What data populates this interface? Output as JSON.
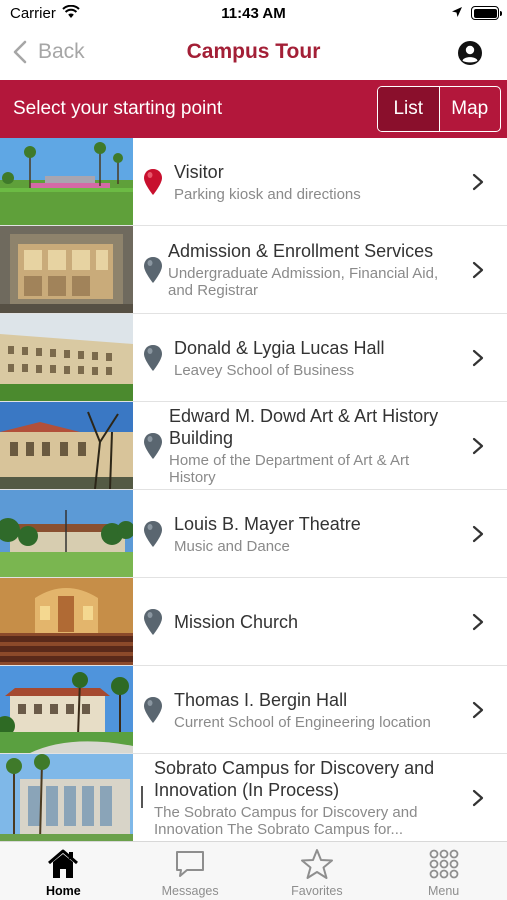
{
  "status_bar": {
    "carrier": "Carrier",
    "time": "11:43 AM"
  },
  "nav": {
    "back_label": "Back",
    "title": "Campus Tour"
  },
  "band": {
    "prompt": "Select your starting point",
    "segments": [
      "List",
      "Map"
    ],
    "selected": "List"
  },
  "colors": {
    "accent": "#b3173b",
    "title": "#a31f36",
    "pin_active": "#c8102e",
    "pin_inactive": "#5a6670"
  },
  "locations": [
    {
      "title": "Visitor",
      "subtitle": "Parking kiosk and directions",
      "pin": "pin-red-icon"
    },
    {
      "title": "Admission & Enrollment Services",
      "subtitle": "Undergraduate Admission, Financial Aid, and Registrar",
      "pin": "pin-gray-icon"
    },
    {
      "title": "Donald & Lygia Lucas Hall",
      "subtitle": "Leavey School of Business",
      "pin": "pin-gray-icon"
    },
    {
      "title": "Edward M. Dowd Art & Art History Building",
      "subtitle": "Home of the Department of Art & Art History",
      "pin": "pin-gray-icon"
    },
    {
      "title": "Louis B. Mayer Theatre",
      "subtitle": "Music and Dance",
      "pin": "pin-gray-icon"
    },
    {
      "title": "Mission Church",
      "subtitle": "",
      "pin": "pin-gray-icon"
    },
    {
      "title": "Thomas I. Bergin Hall",
      "subtitle": "Current School of Engineering location",
      "pin": "pin-gray-icon"
    },
    {
      "title": "Sobrato Campus for Discovery and Innovation (In Process)",
      "subtitle": "The Sobrato Campus for Discovery and Innovation The Sobrato Campus for...",
      "pin": "pin-gray-icon"
    }
  ],
  "tabs": [
    {
      "label": "Home",
      "icon": "home-icon",
      "active": true
    },
    {
      "label": "Messages",
      "icon": "chat-bubble-icon",
      "active": false
    },
    {
      "label": "Favorites",
      "icon": "star-icon",
      "active": false
    },
    {
      "label": "Menu",
      "icon": "grid-menu-icon",
      "active": false
    }
  ]
}
